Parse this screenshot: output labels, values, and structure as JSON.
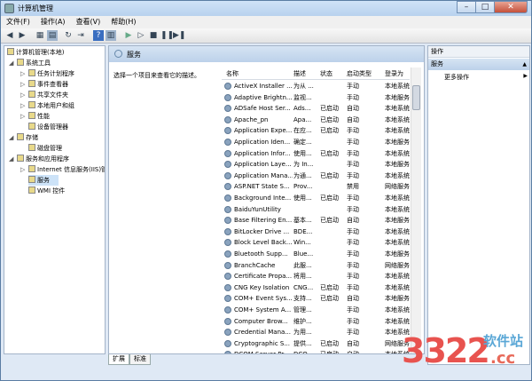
{
  "window": {
    "title": "计算机管理"
  },
  "menu": [
    "文件(F)",
    "操作(A)",
    "查看(V)",
    "帮助(H)"
  ],
  "tree": {
    "root": "计算机管理(本地)",
    "system_tools": "系统工具",
    "task_scheduler": "任务计划程序",
    "event_viewer": "事件查看器",
    "shared_folders": "共享文件夹",
    "local_users": "本地用户和组",
    "performance": "性能",
    "device_manager": "设备管理器",
    "storage": "存储",
    "disk_management": "磁盘管理",
    "services_apps": "服务和应用程序",
    "iis": "Internet 信息服务(IIS)管",
    "services": "服务",
    "wmi": "WMI 控件"
  },
  "center": {
    "header": "服务",
    "description": "选择一个项目来查看它的描述。",
    "columns": [
      "名称",
      "描述",
      "状态",
      "启动类型",
      "登录为"
    ],
    "rows": [
      [
        "ActiveX Installer ...",
        "为从 ...",
        "",
        "手动",
        "本地系统"
      ],
      [
        "Adaptive Brightn...",
        "监视...",
        "",
        "手动",
        "本地服务"
      ],
      [
        "ADSafe Host Ser...",
        "Ads...",
        "已启动",
        "自动",
        "本地系统"
      ],
      [
        "Apache_pn",
        "Apa...",
        "已启动",
        "自动",
        "本地系统"
      ],
      [
        "Application Expe...",
        "在应...",
        "已启动",
        "手动",
        "本地系统"
      ],
      [
        "Application Iden...",
        "确定...",
        "",
        "手动",
        "本地服务"
      ],
      [
        "Application Infor...",
        "使用...",
        "已启动",
        "手动",
        "本地系统"
      ],
      [
        "Application Laye...",
        "为 In...",
        "",
        "手动",
        "本地服务"
      ],
      [
        "Application Mana...",
        "为通...",
        "已启动",
        "手动",
        "本地系统"
      ],
      [
        "ASP.NET State S...",
        "Prov...",
        "",
        "禁用",
        "网络服务"
      ],
      [
        "Background Inte...",
        "使用...",
        "已启动",
        "手动",
        "本地系统"
      ],
      [
        "BaiduYunUtility",
        "",
        "",
        "手动",
        "本地系统"
      ],
      [
        "Base Filtering En...",
        "基本...",
        "已启动",
        "自动",
        "本地服务"
      ],
      [
        "BitLocker Drive ...",
        "BDE...",
        "",
        "手动",
        "本地系统"
      ],
      [
        "Block Level Back...",
        "Win...",
        "",
        "手动",
        "本地系统"
      ],
      [
        "Bluetooth Supp...",
        "Blue...",
        "",
        "手动",
        "本地服务"
      ],
      [
        "BranchCache",
        "此服...",
        "",
        "手动",
        "网络服务"
      ],
      [
        "Certificate Propa...",
        "将用...",
        "",
        "手动",
        "本地系统"
      ],
      [
        "CNG Key Isolation",
        "CNG...",
        "已启动",
        "手动",
        "本地系统"
      ],
      [
        "COM+ Event Sys...",
        "支持...",
        "已启动",
        "自动",
        "本地服务"
      ],
      [
        "COM+ System A...",
        "管理...",
        "",
        "手动",
        "本地系统"
      ],
      [
        "Computer Brow...",
        "维护...",
        "",
        "手动",
        "本地系统"
      ],
      [
        "Credential Mana...",
        "为用...",
        "",
        "手动",
        "本地系统"
      ],
      [
        "Cryptographic S...",
        "提供...",
        "已启动",
        "自动",
        "网络服务"
      ],
      [
        "DCOM Server Pr...",
        "DCO...",
        "已启动",
        "自动",
        "本地系统"
      ]
    ]
  },
  "tabs": [
    "扩展",
    "标准"
  ],
  "actions": {
    "title": "操作",
    "section": "服务",
    "more": "更多操作"
  },
  "watermark": {
    "digits": "3322",
    "cn": "软件站",
    "domain": ".cc"
  }
}
